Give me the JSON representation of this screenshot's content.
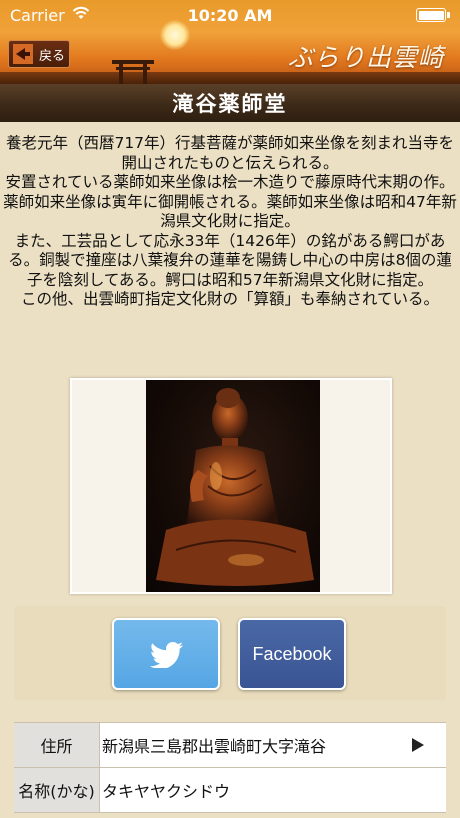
{
  "status_bar": {
    "carrier": "Carrier",
    "time": "10:20 AM",
    "wifi_icon": "wifi-icon",
    "battery_icon": "battery-icon"
  },
  "header": {
    "back_label": "戻る",
    "app_title": "ぶらり出雲崎"
  },
  "page": {
    "title": "滝谷薬師堂",
    "description": [
      "養老元年（西暦717年）行基菩薩が薬師如来坐像を刻まれ当寺を開山されたものと伝えられる。",
      "安置されている薬師如来坐像は桧一木造りで藤原時代末期の作。薬師如来坐像は寅年に御開帳される。薬師如来坐像は昭和47年新潟県文化財に指定。",
      "また、工芸品として応永33年（1426年）の銘がある鰐口がある。銅製で撞座は八葉複弁の蓮華を陽鋳し中心の中房は8個の蓮子を陰刻してある。鰐口は昭和57年新潟県文化財に指定。",
      "この他、出雲崎町指定文化財の「算額」も奉納されている。"
    ]
  },
  "share": {
    "twitter_icon": "twitter-bird-icon",
    "facebook_label": "Facebook"
  },
  "info": [
    {
      "label": "住所",
      "value": "新潟県三島郡出雲崎町大字滝谷",
      "has_chevron": true
    },
    {
      "label": "名称(かな)",
      "value": "タキヤヤクシドウ",
      "has_chevron": false
    }
  ],
  "colors": {
    "background": "#ece0c4",
    "title_bar": "#3d2a18",
    "twitter": "#55a6e4",
    "facebook": "#3a5494"
  }
}
